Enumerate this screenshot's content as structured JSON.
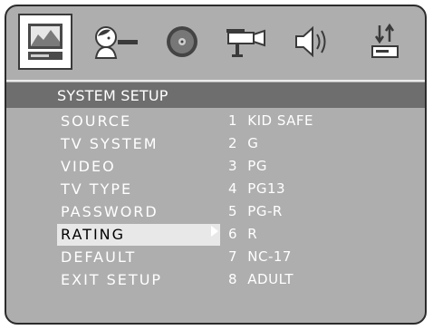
{
  "toolbar": {
    "icons": [
      {
        "name": "system-setup-icon",
        "selected": true
      },
      {
        "name": "language-setup-icon",
        "selected": false
      },
      {
        "name": "audio-setup-icon",
        "selected": false
      },
      {
        "name": "video-setup-icon",
        "selected": false
      },
      {
        "name": "speaker-setup-icon",
        "selected": false
      },
      {
        "name": "digital-setup-icon",
        "selected": false
      }
    ]
  },
  "header": {
    "title": "SYSTEM SETUP"
  },
  "menu": {
    "items": [
      "SOURCE",
      "TV SYSTEM",
      "VIDEO",
      "TV TYPE",
      "PASSWORD",
      "RATING",
      "DEFAULT",
      "EXIT SETUP"
    ],
    "selected_index": 5
  },
  "options": [
    {
      "num": "1",
      "label": "KID SAFE"
    },
    {
      "num": "2",
      "label": "G"
    },
    {
      "num": "3",
      "label": "PG"
    },
    {
      "num": "4",
      "label": "PG13"
    },
    {
      "num": "5",
      "label": "PG-R"
    },
    {
      "num": "6",
      "label": "R"
    },
    {
      "num": "7",
      "label": "NC-17"
    },
    {
      "num": "8",
      "label": "ADULT"
    }
  ],
  "colors": {
    "panel": "#aeaeae",
    "header": "#6e6e6e",
    "highlight": "#e8e8e8",
    "text": "#ffffff"
  }
}
